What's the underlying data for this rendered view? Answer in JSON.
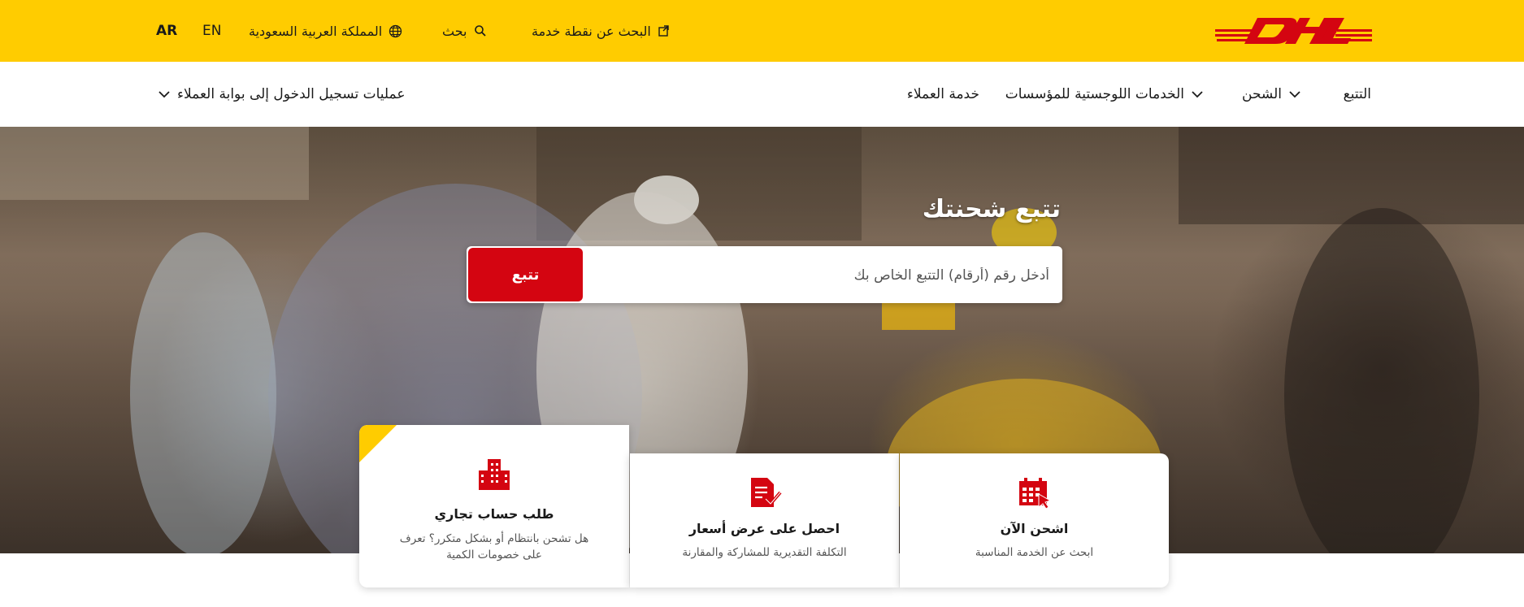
{
  "header": {
    "brand_color": "#ffcc00",
    "logo_text": "DHL",
    "logo_color": "#d40511",
    "service_point_label": "البحث عن نقطة خدمة",
    "search_label": "بحث",
    "country_label": "المملكة العربية السعودية",
    "lang_en": "EN",
    "lang_ar": "AR"
  },
  "nav": {
    "tracking": "التتبع",
    "shipping": "الشحن",
    "logistics": "الخدمات اللوجستية للمؤسسات",
    "customer_service": "خدمة العملاء",
    "portal_login": "عمليات تسجيل الدخول إلى بوابة العملاء"
  },
  "hero": {
    "title": "تتبع شحنتك",
    "input_placeholder": "أدخل رقم (أرقام) التتبع الخاص بك",
    "track_button": "تتبع",
    "accent_color": "#d40511"
  },
  "cards": [
    {
      "icon": "calendar-icon",
      "title": "اشحن الآن",
      "desc": "ابحث عن الخدمة المناسبة"
    },
    {
      "icon": "quote-document-icon",
      "title": "احصل على عرض أسعار",
      "desc": "التكلفة التقديرية للمشاركة والمقارنة"
    },
    {
      "icon": "building-icon",
      "title": "طلب حساب تجاري",
      "desc": "هل تشحن بانتظام أو بشكل متكرر؟ تعرف على خصومات الكمية"
    }
  ]
}
